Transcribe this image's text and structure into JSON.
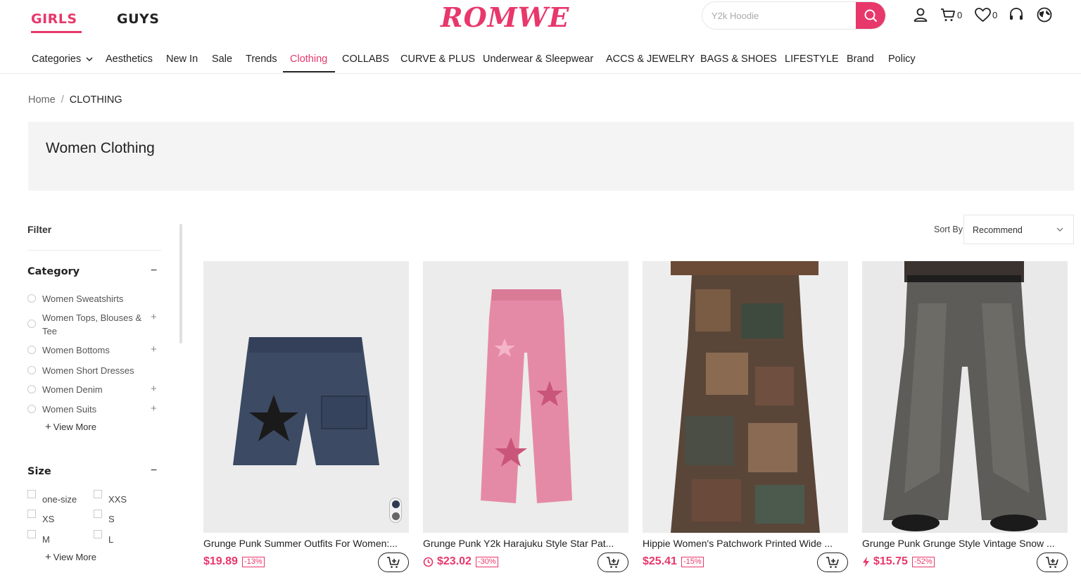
{
  "header": {
    "gender_tabs": [
      "GIRLS",
      "GUYS"
    ],
    "logo": "ROMWE",
    "search_placeholder": "Y2k Hoodie",
    "cart_count": "0",
    "wishlist_count": "0"
  },
  "nav": {
    "items": [
      "Categories",
      "Aesthetics",
      "New In",
      "Sale",
      "Trends",
      "Clothing",
      "COLLABS",
      "CURVE & PLUS",
      "Underwear & Sleepwear",
      "ACCS & JEWELRY",
      "BAGS & SHOES",
      "LIFESTYLE",
      "Brand",
      "Policy"
    ],
    "active": "Clothing"
  },
  "breadcrumb": {
    "home": "Home",
    "separator": "/",
    "current": "CLOTHING"
  },
  "page_title": "Women Clothing",
  "filter": {
    "title": "Filter",
    "category_title": "Category",
    "categories": [
      {
        "label": "Women Sweatshirts",
        "expandable": false
      },
      {
        "label": "Women Tops, Blouses & Tee",
        "expandable": true
      },
      {
        "label": "Women Bottoms",
        "expandable": true
      },
      {
        "label": "Women Short Dresses",
        "expandable": false
      },
      {
        "label": "Women Denim",
        "expandable": true
      },
      {
        "label": "Women Suits",
        "expandable": true
      }
    ],
    "view_more": "View More",
    "size_title": "Size",
    "sizes": [
      "one-size",
      "XXS",
      "XS",
      "S",
      "M",
      "L"
    ],
    "collapse_symbol": "−",
    "expand_symbol": "+"
  },
  "sort": {
    "label": "Sort By",
    "value": "Recommend"
  },
  "products": [
    {
      "title": "Grunge Punk Summer Outfits For Women:...",
      "price": "$19.89",
      "discount": "-13%",
      "price_icon": ""
    },
    {
      "title": "Grunge Punk Y2k Harajuku Style Star Pat...",
      "price": "$23.02",
      "discount": "-30%",
      "price_icon": "clock-icon"
    },
    {
      "title": "Hippie Women's Patchwork Printed Wide ...",
      "price": "$25.41",
      "discount": "-15%",
      "price_icon": ""
    },
    {
      "title": "Grunge Punk Grunge Style Vintage Snow ...",
      "price": "$15.75",
      "discount": "-52%",
      "price_icon": "flash-icon"
    }
  ],
  "colors": {
    "brand": "#e8376b",
    "text": "#222222",
    "banner_bg": "#f4f4f4"
  }
}
